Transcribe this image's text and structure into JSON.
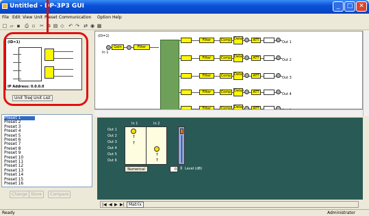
{
  "window": {
    "title": "Untitled - DP-3P3 GUI"
  },
  "menu": [
    "File",
    "Edit",
    "View",
    "Unit",
    "Preset",
    "Communication",
    "Option",
    "Help"
  ],
  "left_panel": {
    "preview_id": "(ID=1)",
    "ip_address": "IP Address: 0.0.0.0",
    "tabs": [
      "Unit Tree",
      "Unit List"
    ]
  },
  "diagram": {
    "id_label": "(ID=1)",
    "input_label": "In 1",
    "gain_label": "Gain",
    "filter_label": "Filter",
    "chain_blocks": [
      "Filter",
      "Comp",
      "Delay",
      "ATT"
    ],
    "outputs": [
      "Out 1",
      "Out 2",
      "Out 3",
      "Out 4",
      "Out 5"
    ]
  },
  "presets": {
    "items": [
      "Preset 1",
      "Preset 2",
      "Preset 3",
      "Preset 4",
      "Preset 5",
      "Preset 6",
      "Preset 7",
      "Preset 8",
      "Preset 9",
      "Preset 10",
      "Preset 11",
      "Preset 12",
      "Preset 13",
      "Preset 14",
      "Preset 15",
      "Preset 16"
    ],
    "buttons": [
      "Change",
      "Store",
      "Compare"
    ]
  },
  "matrix": {
    "inputs": [
      "In 1",
      "In 2"
    ],
    "outputs": [
      "Out 1",
      "Out 2",
      "Out 3",
      "Out 4",
      "Out 5",
      "Out 6"
    ],
    "numerical_label": "Numerical",
    "level_value": "0",
    "level_label": "Level (dB)",
    "sheet_tab": "Matrix"
  },
  "status": {
    "left": "Ready",
    "right": "Administrator"
  }
}
